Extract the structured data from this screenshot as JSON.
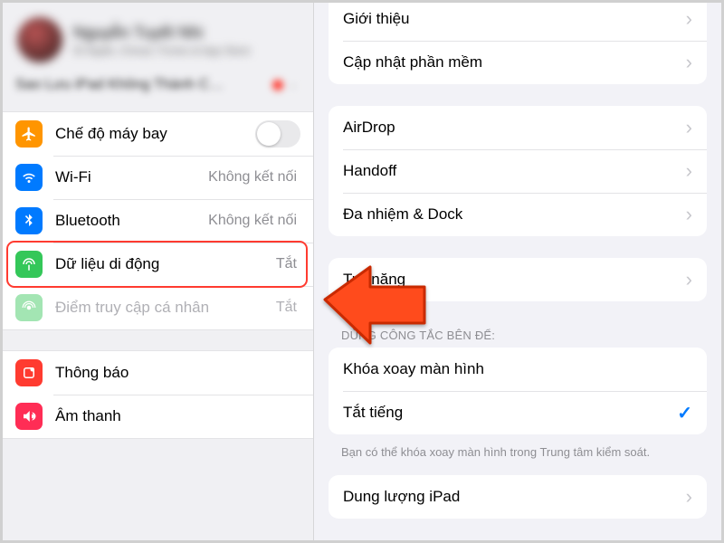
{
  "profile": {
    "name": "Nguyễn Tuyết Nhi",
    "subtitle": "ID Apple, iCloud, iTunes & App Store",
    "backup_row": "Sao Lưu iPad Không Thành C…"
  },
  "sidebar": {
    "airplane": "Chế độ máy bay",
    "wifi": {
      "label": "Wi-Fi",
      "value": "Không kết nối"
    },
    "bluetooth": {
      "label": "Bluetooth",
      "value": "Không kết nối"
    },
    "cellular": {
      "label": "Dữ liệu di động",
      "value": "Tắt"
    },
    "hotspot": {
      "label": "Điểm truy cập cá nhân",
      "value": "Tắt"
    },
    "notifications": "Thông báo",
    "sound": "Âm thanh"
  },
  "main": {
    "about": "Giới thiệu",
    "update": "Cập nhật phần mềm",
    "airdrop": "AirDrop",
    "handoff": "Handoff",
    "multitask": "Đa nhiệm & Dock",
    "accessibility": "Trợ năng",
    "switch_header": "DÙNG CÔNG TẮC BÊN ĐỂ:",
    "lock_rotation": "Khóa xoay màn hình",
    "mute": "Tắt tiếng",
    "switch_footer": "Bạn có thể khóa xoay màn hình trong Trung tâm kiểm soát.",
    "storage": "Dung lượng iPad"
  }
}
